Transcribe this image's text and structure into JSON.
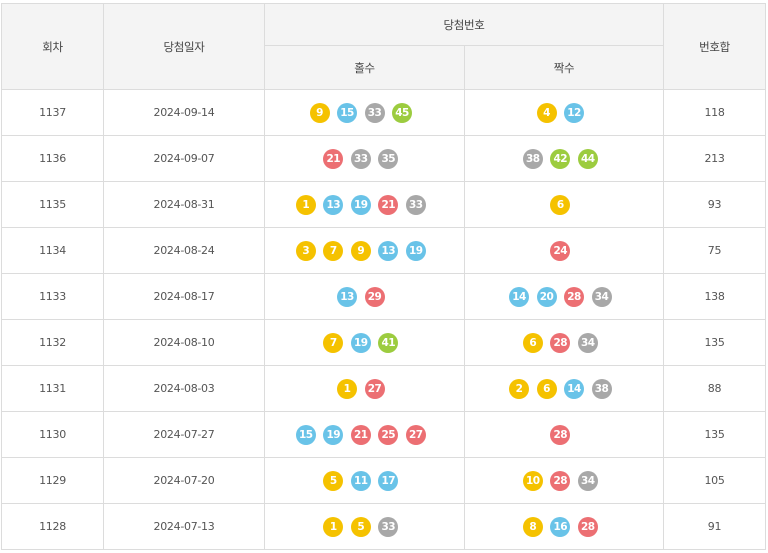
{
  "headers": {
    "round": "회차",
    "date": "당첨일자",
    "numbers": "당첨번호",
    "odd": "홀수",
    "even": "짝수",
    "sum": "번호합"
  },
  "ball_colors": {
    "yellow": "#f5c200",
    "blue": "#69c3e8",
    "red": "#ec6f73",
    "gray": "#a8a8a8",
    "green": "#9ccc3f"
  },
  "rows": [
    {
      "round": "1137",
      "date": "2024-09-14",
      "odd": [
        "9",
        "15",
        "33",
        "45"
      ],
      "even": [
        "4",
        "12"
      ],
      "sum": "118"
    },
    {
      "round": "1136",
      "date": "2024-09-07",
      "odd": [
        "21",
        "33",
        "35"
      ],
      "even": [
        "38",
        "42",
        "44"
      ],
      "sum": "213"
    },
    {
      "round": "1135",
      "date": "2024-08-31",
      "odd": [
        "1",
        "13",
        "19",
        "21",
        "33"
      ],
      "even": [
        "6"
      ],
      "sum": "93"
    },
    {
      "round": "1134",
      "date": "2024-08-24",
      "odd": [
        "3",
        "7",
        "9",
        "13",
        "19"
      ],
      "even": [
        "24"
      ],
      "sum": "75"
    },
    {
      "round": "1133",
      "date": "2024-08-17",
      "odd": [
        "13",
        "29"
      ],
      "even": [
        "14",
        "20",
        "28",
        "34"
      ],
      "sum": "138"
    },
    {
      "round": "1132",
      "date": "2024-08-10",
      "odd": [
        "7",
        "19",
        "41"
      ],
      "even": [
        "6",
        "28",
        "34"
      ],
      "sum": "135"
    },
    {
      "round": "1131",
      "date": "2024-08-03",
      "odd": [
        "1",
        "27"
      ],
      "even": [
        "2",
        "6",
        "14",
        "38"
      ],
      "sum": "88"
    },
    {
      "round": "1130",
      "date": "2024-07-27",
      "odd": [
        "15",
        "19",
        "21",
        "25",
        "27"
      ],
      "even": [
        "28"
      ],
      "sum": "135"
    },
    {
      "round": "1129",
      "date": "2024-07-20",
      "odd": [
        "5",
        "11",
        "17"
      ],
      "even": [
        "10",
        "28",
        "34"
      ],
      "sum": "105"
    },
    {
      "round": "1128",
      "date": "2024-07-13",
      "odd": [
        "1",
        "5",
        "33"
      ],
      "even": [
        "8",
        "16",
        "28"
      ],
      "sum": "91"
    }
  ]
}
